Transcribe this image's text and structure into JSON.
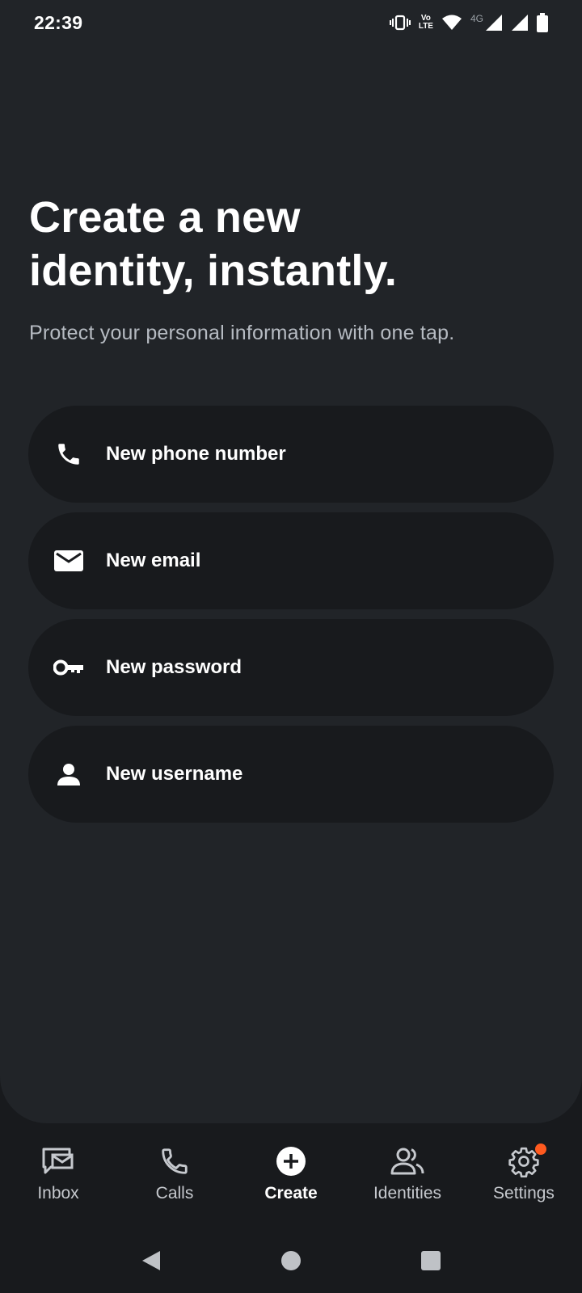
{
  "status_bar": {
    "time": "22:39",
    "network": "4G",
    "volte_top": "Vo",
    "volte_bottom": "LTE",
    "icons": [
      "vibrate-icon",
      "volte-icon",
      "wifi-icon",
      "signal-icon",
      "signal-icon",
      "battery-icon"
    ]
  },
  "hero": {
    "title_line1": "Create a new",
    "title_line2": "identity, instantly.",
    "subtitle": "Protect your personal information with one tap."
  },
  "options": [
    {
      "label": "New phone number",
      "icon": "phone-icon"
    },
    {
      "label": "New email",
      "icon": "email-icon"
    },
    {
      "label": "New password",
      "icon": "key-icon"
    },
    {
      "label": "New username",
      "icon": "person-icon"
    }
  ],
  "bottom_nav": {
    "items": [
      {
        "label": "Inbox",
        "icon": "inbox-icon"
      },
      {
        "label": "Calls",
        "icon": "phone-icon"
      },
      {
        "label": "Create",
        "icon": "add-icon",
        "active": true
      },
      {
        "label": "Identities",
        "icon": "people-icon"
      },
      {
        "label": "Settings",
        "icon": "gear-icon",
        "has_notification": true
      }
    ]
  },
  "colors": {
    "background": "#181a1d",
    "panel": "#212428",
    "option_bg": "#181a1d",
    "notification": "#ff5a1f",
    "subtitle": "#b6bbc2"
  }
}
